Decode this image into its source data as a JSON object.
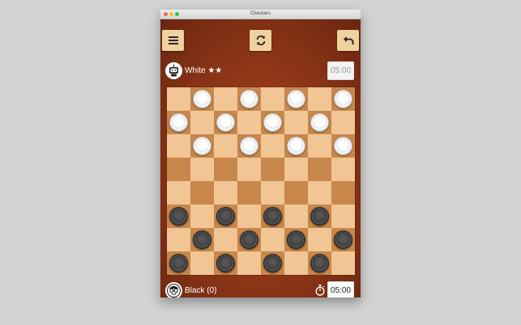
{
  "window": {
    "title": "Checkers"
  },
  "toolbar": {
    "menu_icon": "hamburger-menu-icon",
    "restart_icon": "refresh-icon",
    "undo_icon": "undo-arrow-icon"
  },
  "top_player": {
    "name": "White ★★",
    "avatar_icon": "robot-icon",
    "timer": "05:00"
  },
  "bottom_player": {
    "name": "Black (0)",
    "avatar_icon": "person-with-glasses-icon",
    "clock_icon": "stopwatch-icon",
    "timer": "05:00"
  },
  "board": {
    "size": 8,
    "colors": {
      "light": "#f1c594",
      "dark": "#c8874b"
    },
    "rows": [
      "-w-w-w-w",
      "w-w-w-w-",
      "-w-w-w-w",
      "--------",
      "--------",
      "b-b-b-b-",
      "-b-b-b-b",
      "b-b-b-b-"
    ]
  }
}
